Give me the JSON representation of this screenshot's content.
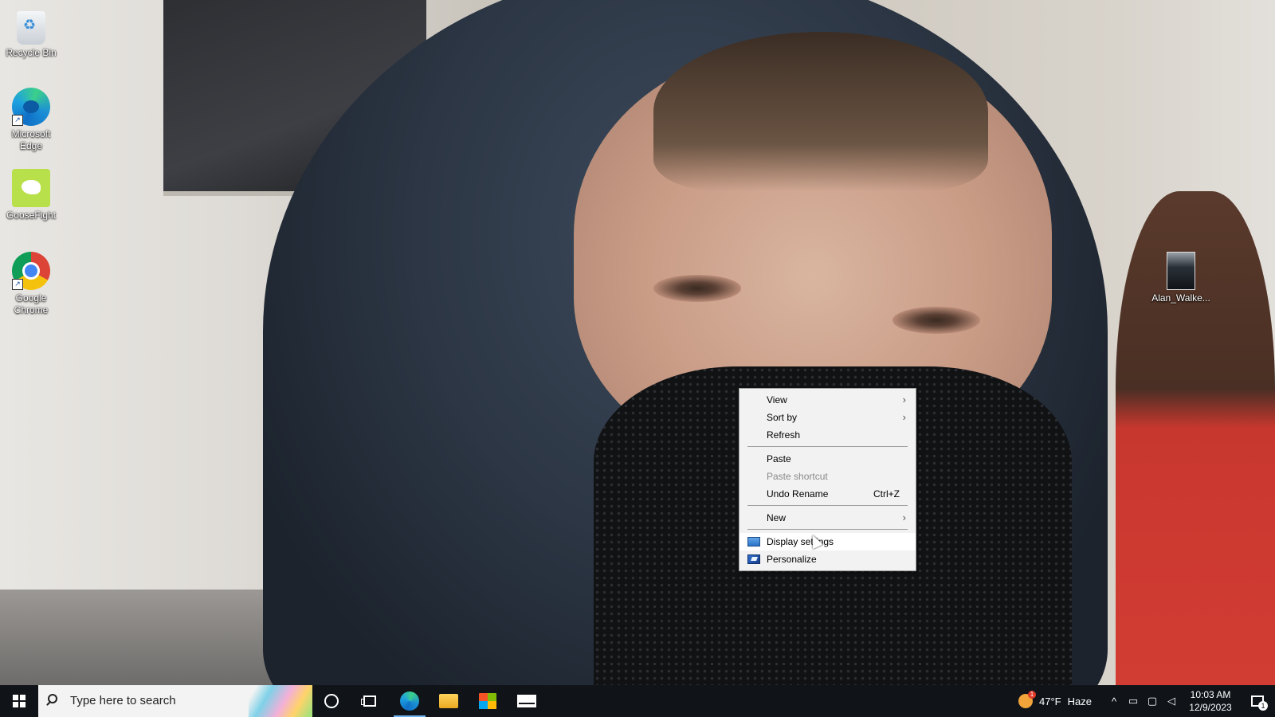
{
  "desktop": {
    "icons": [
      {
        "label": "Recycle Bin",
        "icon": "recycle-bin-icon"
      },
      {
        "label": "Microsoft Edge",
        "icon": "edge-icon"
      },
      {
        "label": "GooseFight",
        "icon": "goose-icon"
      },
      {
        "label": "Google Chrome",
        "icon": "chrome-icon"
      },
      {
        "label": "Alan_Walke...",
        "icon": "image-file-icon"
      }
    ]
  },
  "context_menu": {
    "items": [
      {
        "label": "View",
        "submenu": true
      },
      {
        "label": "Sort by",
        "submenu": true
      },
      {
        "label": "Refresh"
      },
      {
        "label": "Paste"
      },
      {
        "label": "Paste shortcut",
        "disabled": true
      },
      {
        "label": "Undo Rename",
        "shortcut": "Ctrl+Z"
      },
      {
        "label": "New",
        "submenu": true
      },
      {
        "label": "Display settings",
        "icon": "display-icon",
        "hovered": true
      },
      {
        "label": "Personalize",
        "icon": "personalize-icon"
      }
    ]
  },
  "taskbar": {
    "search_placeholder": "Type here to search",
    "pinned": [
      "cortana-icon",
      "task-view-icon",
      "edge-icon",
      "file-explorer-icon",
      "store-icon",
      "mail-icon"
    ],
    "weather": {
      "temp": "47°F",
      "condition": "Haze",
      "badge": "1"
    },
    "clock": {
      "time": "10:03 AM",
      "date": "12/9/2023"
    },
    "notification_count": "1",
    "accent_color": "#6fb2f0"
  }
}
